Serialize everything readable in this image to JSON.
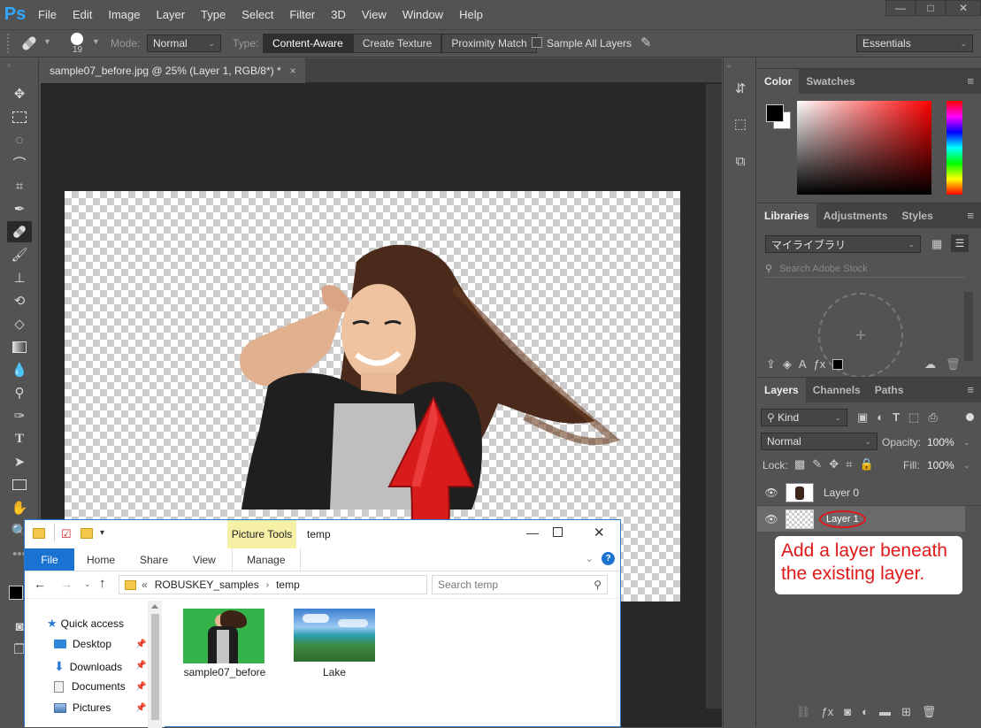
{
  "app": {
    "logo": "Ps",
    "title": "Photoshop"
  },
  "menu": [
    "File",
    "Edit",
    "Image",
    "Layer",
    "Type",
    "Select",
    "Filter",
    "3D",
    "View",
    "Window",
    "Help"
  ],
  "window_controls": {
    "min": "—",
    "max": "□",
    "close": "✕"
  },
  "options": {
    "brush_size": "19",
    "mode_label": "Mode:",
    "mode_value": "Normal",
    "type_label": "Type:",
    "type_buttons": [
      "Content-Aware",
      "Create Texture",
      "Proximity Match"
    ],
    "sample_all_layers": "Sample All Layers",
    "workspace": "Essentials"
  },
  "document": {
    "tab_title": "sample07_before.jpg @ 25% (Layer 1, RGB/8*) *",
    "close": "×"
  },
  "color_panel": {
    "tabs": [
      "Color",
      "Swatches"
    ]
  },
  "libraries_panel": {
    "tabs": [
      "Libraries",
      "Adjustments",
      "Styles"
    ],
    "library_name": "マイライブラリ",
    "search_placeholder": "Search Adobe Stock",
    "add": "+"
  },
  "layers_panel": {
    "tabs": [
      "Layers",
      "Channels",
      "Paths"
    ],
    "kind_label": "Kind",
    "blend_mode": "Normal",
    "opacity_label": "Opacity:",
    "opacity_value": "100%",
    "lock_label": "Lock:",
    "fill_label": "Fill:",
    "fill_value": "100%",
    "layers": [
      {
        "name": "Layer 0",
        "selected": false
      },
      {
        "name": "Layer 1",
        "selected": true
      }
    ]
  },
  "annotation": {
    "text": "Add a layer beneath the existing layer.",
    "color": "#e01818"
  },
  "explorer": {
    "title": "temp",
    "context_tab": "Picture Tools",
    "context_sub": "Manage",
    "tabs": [
      "File",
      "Home",
      "Share",
      "View"
    ],
    "path": [
      "ROBUSKEY_samples",
      "temp"
    ],
    "path_prefix": "«",
    "search_placeholder": "Search temp",
    "nav": [
      {
        "label": "Quick access",
        "icon": "star-icon"
      },
      {
        "label": "Desktop",
        "icon": "desktop-icon"
      },
      {
        "label": "Downloads",
        "icon": "download-icon"
      },
      {
        "label": "Documents",
        "icon": "documents-icon"
      },
      {
        "label": "Pictures",
        "icon": "pictures-icon"
      }
    ],
    "files": [
      {
        "name": "sample07_before"
      },
      {
        "name": "Lake"
      }
    ]
  }
}
